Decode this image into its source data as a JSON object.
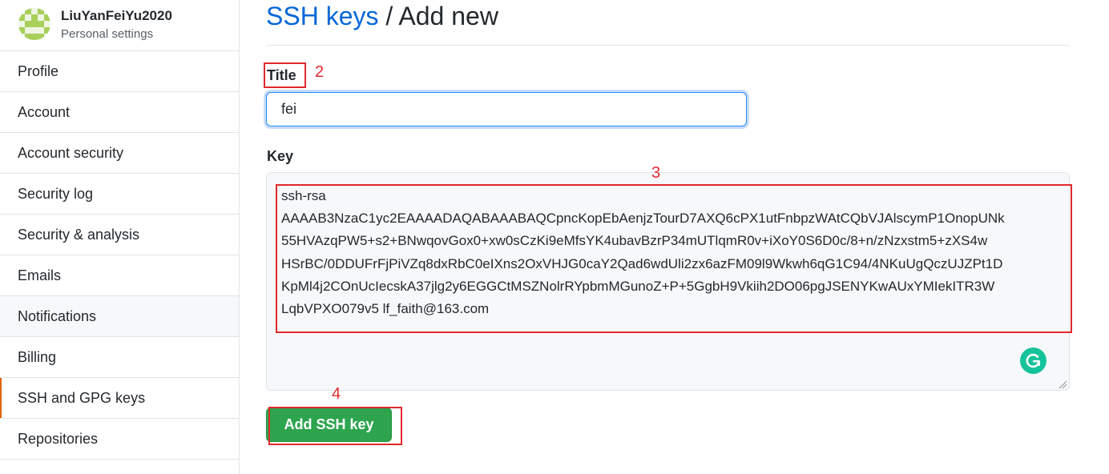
{
  "user": {
    "name": "LiuYanFeiYu2020",
    "subtitle": "Personal settings"
  },
  "sidebar": {
    "items": [
      {
        "label": "Profile"
      },
      {
        "label": "Account"
      },
      {
        "label": "Account security"
      },
      {
        "label": "Security log"
      },
      {
        "label": "Security & analysis"
      },
      {
        "label": "Emails"
      },
      {
        "label": "Notifications"
      },
      {
        "label": "Billing"
      },
      {
        "label": "SSH and GPG keys"
      },
      {
        "label": "Repositories"
      }
    ],
    "selected": "SSH and GPG keys",
    "hovered": "Notifications"
  },
  "header": {
    "crumb": "SSH keys",
    "separator": " / ",
    "title": "Add new"
  },
  "form": {
    "title_label": "Title",
    "title_value": "fei",
    "key_label": "Key",
    "key_value": "ssh-rsa\nAAAAB3NzaC1yc2EAAAADAQABAAABAQCpncKopEbAenjzTourD7AXQ6cPX1utFnbpzWAtCQbVJAlscymP1OnopUNk\n55HVAzqPW5+s2+BNwqovGox0+xw0sCzKi9eMfsYK4ubavBzrP34mUTlqmR0v+iXoY0S6D0c/8+n/zNzxstm5+zXS4w\nHSrBC/0DDUFrFjPiVZq8dxRbC0eIXns2OxVHJG0caY2Qad6wdUli2zx6azFM09l9Wkwh6qG1C94/4NKuUgQczUJZPt1D\nKpMl4j2COnUcIecskA37jlg2y6EGGCtMSZNolrRYpbmMGunoZ+P+5GgbH9Vkiih2DO06pgJSENYKwAUxYMIekITR3W\nLqbVPXO079v5 lf_faith@163.com",
    "submit_label": "Add SSH key"
  },
  "annotations": {
    "title_step": "2",
    "key_step": "3",
    "submit_step": "4"
  },
  "colors": {
    "link": "#0366d6",
    "primary_button": "#2ea44f",
    "annotation": "#e0292c",
    "selected_indicator": "#e36209",
    "grammarly": "#15c39a"
  },
  "icons": {
    "avatar": "identicon-avatar",
    "grammarly": "grammarly-icon",
    "resize": "textarea-resize-grip"
  }
}
